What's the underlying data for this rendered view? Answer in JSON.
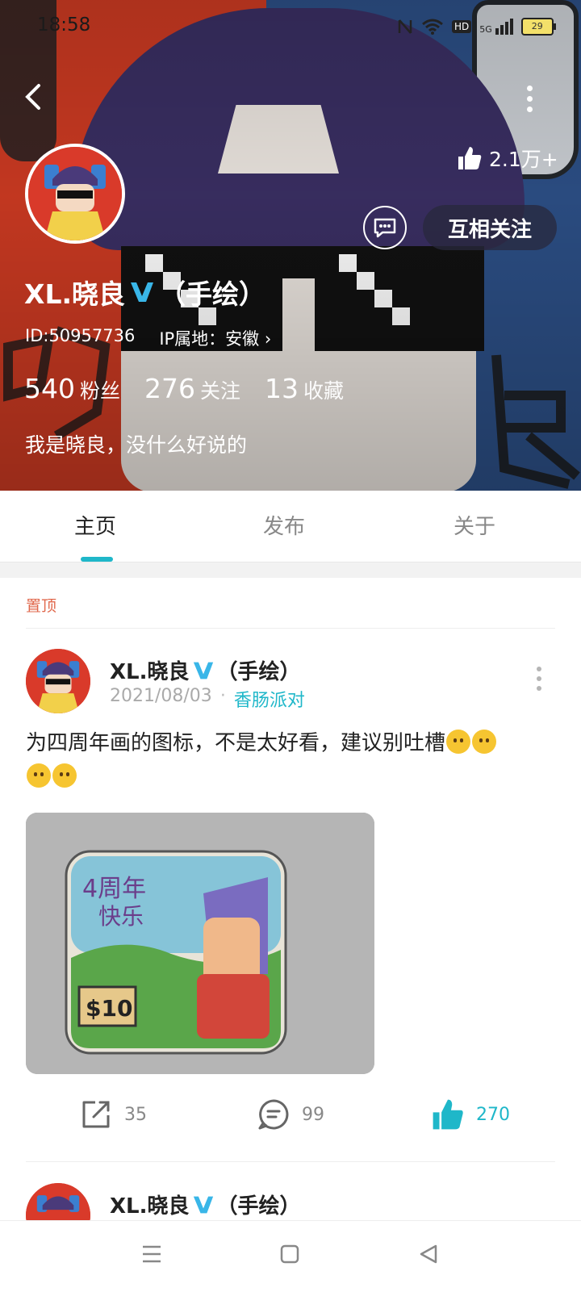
{
  "status_bar": {
    "time": "18:58",
    "network": "5G",
    "hd": "HD",
    "battery": "29"
  },
  "header": {
    "like_total": "2.1万+",
    "follow_button": "互相关注"
  },
  "profile": {
    "name": "XL.晓良",
    "name_suffix": "（手绘）",
    "id": "ID:50957736",
    "ip": "IP属地：安徽",
    "stats": [
      {
        "value": "540",
        "label": "粉丝"
      },
      {
        "value": "276",
        "label": "关注"
      },
      {
        "value": "13",
        "label": "收藏"
      }
    ],
    "bio": "我是晓良，没什么好说的"
  },
  "tabs": [
    {
      "label": "主页",
      "active": true
    },
    {
      "label": "发布",
      "active": false
    },
    {
      "label": "关于",
      "active": false
    }
  ],
  "feed": {
    "pinned_label": "置顶",
    "post1": {
      "author": "XL.晓良",
      "author_suffix": "（手绘）",
      "date": "2021/08/03",
      "channel": "香肠派对",
      "text": "为四周年画的图标，不是太好看，建议别吐槽",
      "share_count": "35",
      "comment_count": "99",
      "like_count": "270",
      "image": {
        "line1": "4周年",
        "line2": "快乐",
        "sign": "$10"
      }
    },
    "post2": {
      "author": "XL.晓良",
      "author_suffix": "（手绘）"
    }
  },
  "colors": {
    "accent": "#1fb7c9",
    "pinned": "#e0674b",
    "verified": "#39b6e8"
  }
}
